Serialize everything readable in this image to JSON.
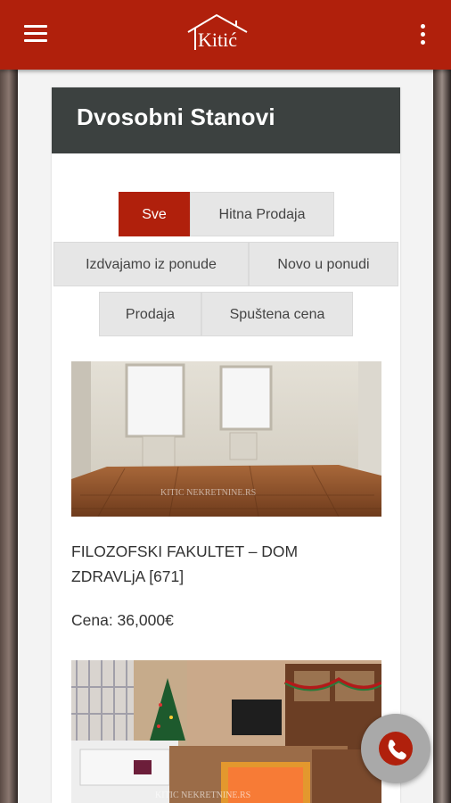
{
  "app": {
    "logo_text": "Kitić"
  },
  "page": {
    "title": "Dvosobni Stanovi"
  },
  "filters": {
    "row1": [
      "Sve",
      "Hitna Prodaja"
    ],
    "row2": [
      "Izdvajamo iz ponude",
      "Novo u ponudi"
    ],
    "row3": [
      "Prodaja",
      "Spuštena cena"
    ],
    "active": "Sve"
  },
  "listings": [
    {
      "title": "FILOZOFSKI FAKULTET – DOM ZDRAVLjA [671]",
      "price": "Cena: 36,000€",
      "watermark": "KITIC NEKRETNINE.RS"
    },
    {
      "watermark": "KITIC NEKRETNINE.RS"
    }
  ],
  "colors": {
    "brand": "#b0200c",
    "header_dark": "#3c4140",
    "fab": "#a9a9a9"
  }
}
